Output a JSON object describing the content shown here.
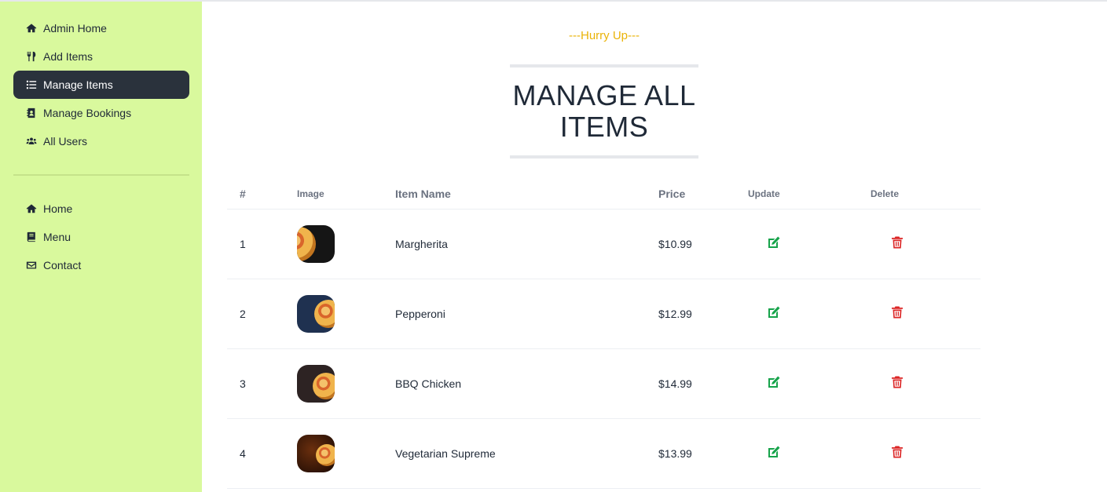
{
  "sidebar": {
    "admin_items": [
      {
        "label": "Admin Home",
        "icon": "home-icon"
      },
      {
        "label": "Add Items",
        "icon": "utensils-icon"
      },
      {
        "label": "Manage Items",
        "icon": "list-icon",
        "active": true
      },
      {
        "label": "Manage Bookings",
        "icon": "address-book-icon"
      },
      {
        "label": "All Users",
        "icon": "users-icon"
      }
    ],
    "site_items": [
      {
        "label": "Home",
        "icon": "home-icon"
      },
      {
        "label": "Menu",
        "icon": "book-icon"
      },
      {
        "label": "Contact",
        "icon": "envelope-icon"
      }
    ]
  },
  "main": {
    "subheading": "---Hurry Up---",
    "heading_line1": "MANAGE ALL",
    "heading_line2": "ITEMS"
  },
  "table": {
    "headers": {
      "num": "#",
      "image": "Image",
      "name": "Item Name",
      "price": "Price",
      "update": "Update",
      "delete": "Delete"
    },
    "rows": [
      {
        "num": "1",
        "name": "Margherita",
        "price": "$10.99"
      },
      {
        "num": "2",
        "name": "Pepperoni",
        "price": "$12.99"
      },
      {
        "num": "3",
        "name": "BBQ Chicken",
        "price": "$14.99"
      },
      {
        "num": "4",
        "name": "Vegetarian Supreme",
        "price": "$13.99"
      }
    ]
  },
  "colors": {
    "sidebar_bg": "#d9f99d",
    "active_item_bg": "#2a323c",
    "accent_yellow": "#eab308",
    "update_green": "#16a34a",
    "delete_red": "#dc2626"
  }
}
